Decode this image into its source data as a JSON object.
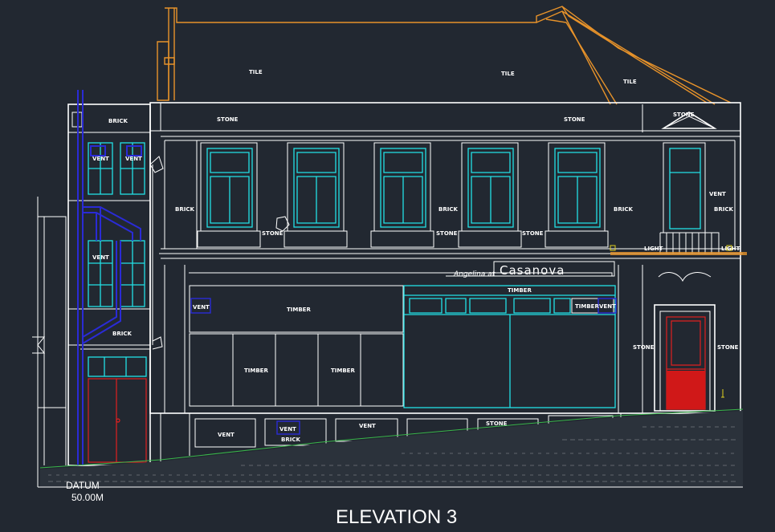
{
  "drawing": {
    "title": "ELEVATION 3",
    "datum_label": "DATUM",
    "datum_value": "50.00M",
    "shop_sign": {
      "small": "Angelina at",
      "large": "Casanova"
    },
    "labels": {
      "tile": "TILE",
      "brick": "BRICK",
      "stone": "STONE",
      "timber": "TIMBER",
      "vent": "VENT",
      "light": "LIGHT"
    }
  },
  "colors": {
    "background": "#222831",
    "lines": "#ffffff",
    "windows": "#22e0e6",
    "downpipe": "#2a2bd6",
    "roof": "#e8932a",
    "door": "#e02020",
    "ground": "#39b54a",
    "lights": "#e0d020"
  }
}
